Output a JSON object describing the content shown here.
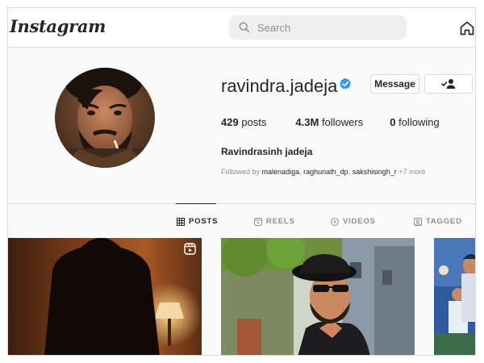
{
  "topbar": {
    "logo": "Instagram",
    "search_placeholder": "Search"
  },
  "profile": {
    "username": "ravindra.jadeja",
    "message_label": "Message",
    "stats": {
      "posts_count": "429",
      "posts_label": "posts",
      "followers_count": "4.3M",
      "followers_label": "followers",
      "following_count": "0",
      "following_label": "following"
    },
    "full_name": "Ravindrasinh jadeja",
    "followed_by_prefix": "Followed by",
    "followed_by_users": [
      "malenadiga",
      "raghunath_dp",
      "sakshisingh_r"
    ],
    "followed_by_more": "+7 more"
  },
  "tabs": [
    {
      "label": "POSTS"
    },
    {
      "label": "REELS"
    },
    {
      "label": "VIDEOS"
    },
    {
      "label": "TAGGED"
    }
  ],
  "colors": {
    "verified": "#3897f0",
    "border": "#dbdbdb",
    "muted": "#8e8e8e"
  }
}
